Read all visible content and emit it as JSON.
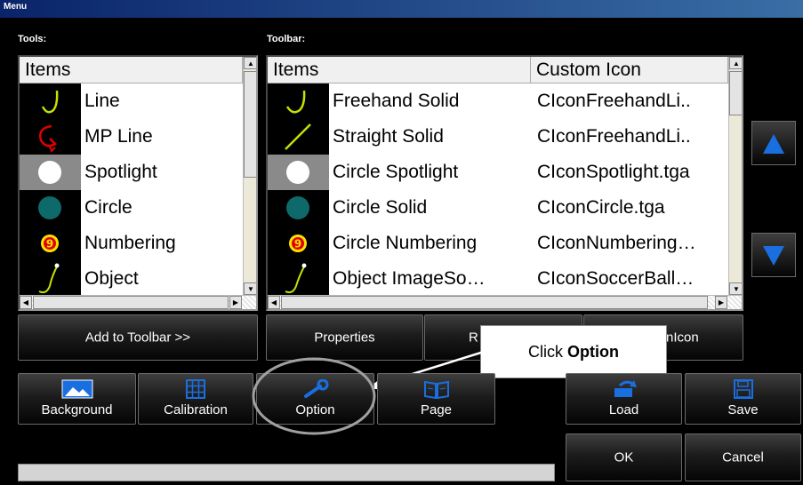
{
  "window": {
    "title": "Menu"
  },
  "tools": {
    "label": "Tools:",
    "header": "Items",
    "items": [
      {
        "name": "Line",
        "icon": "freehand-line-icon"
      },
      {
        "name": "MP Line",
        "icon": "mp-line-icon"
      },
      {
        "name": "Spotlight",
        "icon": "spotlight-icon"
      },
      {
        "name": "Circle",
        "icon": "circle-icon"
      },
      {
        "name": "Numbering",
        "icon": "numbering-icon"
      },
      {
        "name": "Object",
        "icon": "object-icon"
      }
    ]
  },
  "toolbar": {
    "label": "Toolbar:",
    "headers": {
      "items": "Items",
      "custom_icon": "Custom Icon"
    },
    "items": [
      {
        "name": "Freehand Solid",
        "custom_icon": "CIconFreehandLi..",
        "icon": "freehand-line-icon"
      },
      {
        "name": "Straight Solid",
        "custom_icon": "CIconFreehandLi..",
        "icon": "straight-line-icon"
      },
      {
        "name": "Circle Spotlight",
        "custom_icon": "CIconSpotlight.tga",
        "icon": "spotlight-icon"
      },
      {
        "name": "Circle Solid",
        "custom_icon": "CIconCircle.tga",
        "icon": "circle-icon"
      },
      {
        "name": "Circle Numbering",
        "custom_icon": "CIconNumbering…",
        "icon": "numbering-icon"
      },
      {
        "name": "Object ImageSo…",
        "custom_icon": "CIconSoccerBall…",
        "icon": "object-icon"
      }
    ]
  },
  "buttons": {
    "add_to_toolbar": "Add to Toolbar >>",
    "properties": "Properties",
    "remove_partial": "R",
    "custom_icon_partial": "nIcon",
    "background": "Background",
    "calibration": "Calibration",
    "option": "Option",
    "page": "Page",
    "load": "Load",
    "save": "Save",
    "ok": "OK",
    "cancel": "Cancel"
  },
  "callout": {
    "prefix": "Click ",
    "emphasis": "Option"
  },
  "colors": {
    "title_bar": "#0a246a",
    "arrow_blue": "#1a6fe0",
    "line_yellow_green": "#c6e000",
    "mp_line_red": "#e00000",
    "circle_teal": "#0e6a6a",
    "numbering_yellow": "#ffe000",
    "highlight_ring": "#a0a0a0"
  }
}
